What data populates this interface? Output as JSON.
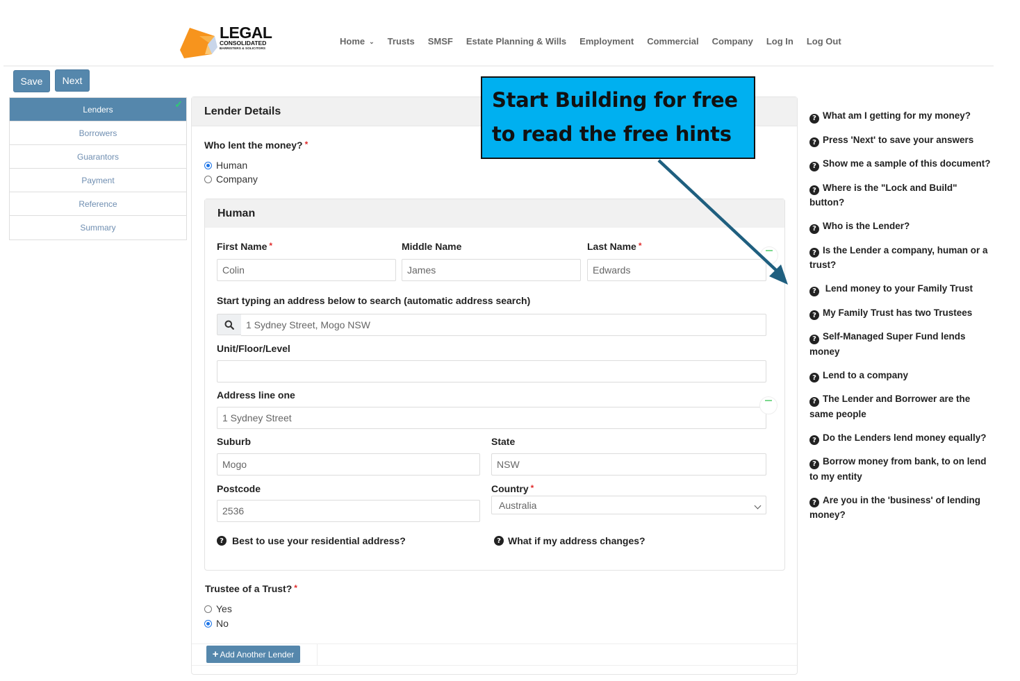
{
  "brand": {
    "name_line1": "LEGAL",
    "name_line2": "CONSOLIDATED",
    "name_line3": "BARRISTERS & SOLICITORS",
    "colors": {
      "orange": "#f7941d",
      "accent_blue": "#5587ac",
      "callout": "#00b0f0",
      "arrow": "#1f5f7f"
    }
  },
  "nav": {
    "items": [
      {
        "label": "Home",
        "has_dropdown": true
      },
      {
        "label": "Trusts"
      },
      {
        "label": "SMSF"
      },
      {
        "label": "Estate Planning & Wills"
      },
      {
        "label": "Employment"
      },
      {
        "label": "Commercial"
      },
      {
        "label": "Company"
      },
      {
        "label": "Log In"
      },
      {
        "label": "Log Out"
      }
    ]
  },
  "toolbar": {
    "save_label": "Save",
    "next_label": "Next"
  },
  "steps": [
    {
      "label": "Lenders",
      "active": true,
      "completed": true
    },
    {
      "label": "Borrowers"
    },
    {
      "label": "Guarantors"
    },
    {
      "label": "Payment"
    },
    {
      "label": "Reference"
    },
    {
      "label": "Summary"
    }
  ],
  "form": {
    "title": "Lender Details",
    "who_lent": {
      "label": "Who lent the money?",
      "required": "*",
      "options": [
        {
          "label": "Human",
          "checked": true
        },
        {
          "label": "Company",
          "checked": false
        }
      ]
    },
    "human": {
      "title": "Human",
      "first_name": {
        "label": "First Name",
        "required": "*",
        "value": "Colin"
      },
      "middle_name": {
        "label": "Middle Name",
        "value": "James"
      },
      "last_name": {
        "label": "Last Name",
        "required": "*",
        "value": "Edwards"
      },
      "address_search": {
        "label": "Start typing an address below to search (automatic address search)",
        "value": "1 Sydney Street, Mogo NSW",
        "icon": "search-icon"
      },
      "unit": {
        "label": "Unit/Floor/Level",
        "value": ""
      },
      "address_line_one": {
        "label": "Address line one",
        "value": "1 Sydney Street"
      },
      "suburb": {
        "label": "Suburb",
        "value": "Mogo"
      },
      "state": {
        "label": "State",
        "value": "NSW"
      },
      "postcode": {
        "label": "Postcode",
        "value": "2536"
      },
      "country": {
        "label": "Country",
        "required": "*",
        "value": "Australia"
      },
      "help_residential": "Best to use your residential address?",
      "help_address_changes": "What if my address changes?"
    },
    "trustee": {
      "label": "Trustee of a Trust?",
      "required": "*",
      "options": [
        {
          "label": "Yes",
          "checked": false
        },
        {
          "label": "No",
          "checked": true
        }
      ]
    },
    "add_lender_label": "Add Another Lender"
  },
  "hints": [
    "What am I getting for my money?",
    "Press 'Next' to save your answers",
    "Show me a sample of this document?",
    "Where is the \"Lock and Build\" button?",
    "Who is the Lender?",
    "Is the Lender a company, human or a trust?",
    " Lend money to your Family Trust",
    "My Family Trust has two Trustees",
    "Self-Managed Super Fund lends money",
    "Lend to a company",
    "The Lender and Borrower are the same people",
    "Do the Lenders lend money equally?",
    "Borrow money from bank, to on lend to my entity",
    "Are you in the 'business' of lending money?"
  ],
  "callout": {
    "line1": "Start Building for free",
    "line2": "to read the free hints"
  }
}
